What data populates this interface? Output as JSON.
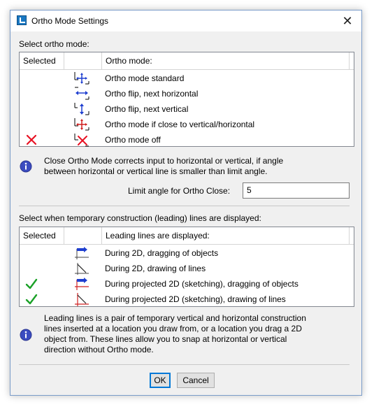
{
  "window": {
    "title": "Ortho Mode Settings",
    "close_glyph": "✕"
  },
  "ortho_section": {
    "heading": "Select ortho mode:",
    "columns": {
      "selected": "Selected",
      "icon": "",
      "mode": "Ortho mode:"
    },
    "rows": [
      {
        "label": "Ortho mode standard",
        "selected": false,
        "icon": "ortho-standard-icon"
      },
      {
        "label": "Ortho flip, next horizontal",
        "selected": false,
        "icon": "ortho-flip-horizontal-icon"
      },
      {
        "label": "Ortho flip, next vertical",
        "selected": false,
        "icon": "ortho-flip-vertical-icon"
      },
      {
        "label": "Ortho mode if close to vertical/horizontal",
        "selected": false,
        "icon": "ortho-close-icon"
      },
      {
        "label": "Ortho mode off",
        "selected": true,
        "icon": "ortho-off-icon",
        "mark": "red-x"
      }
    ],
    "info_line1": "Close Ortho Mode corrects input to horizontal or vertical,  if angle",
    "info_line2": "between horizontal or vertical line is smaller than limit angle.",
    "limit_label": "Limit angle for Ortho Close:",
    "limit_value": "5"
  },
  "leading_section": {
    "heading": "Select when temporary construction (leading) lines are displayed:",
    "columns": {
      "selected": "Selected",
      "icon": "",
      "mode": "Leading lines are displayed:"
    },
    "rows": [
      {
        "label": "During 2D, dragging of objects",
        "selected": false,
        "icon": "drag-2d-icon"
      },
      {
        "label": "During 2D, drawing of lines",
        "selected": false,
        "icon": "draw-2d-icon"
      },
      {
        "label": "During projected 2D (sketching), dragging of objects",
        "selected": true,
        "icon": "drag-projected-icon",
        "mark": "green-check"
      },
      {
        "label": "During projected 2D (sketching), drawing of lines",
        "selected": true,
        "icon": "draw-projected-icon",
        "mark": "green-check"
      }
    ],
    "info_line1": "Leading lines is a pair of temporary vertical and horizontal construction",
    "info_line2": "lines inserted at a location you draw from, or a location you drag a 2D",
    "info_line3": "object from. These lines allow you to snap at horizontal or vertical",
    "info_line4": "direction without Ortho mode."
  },
  "buttons": {
    "ok": "OK",
    "cancel": "Cancel"
  },
  "colors": {
    "selected_x": "#e81123",
    "selected_check": "#1aa127",
    "accent_blue": "#1f3fd0",
    "accent_red": "#d02020",
    "info_blue": "#3b4cc0"
  }
}
